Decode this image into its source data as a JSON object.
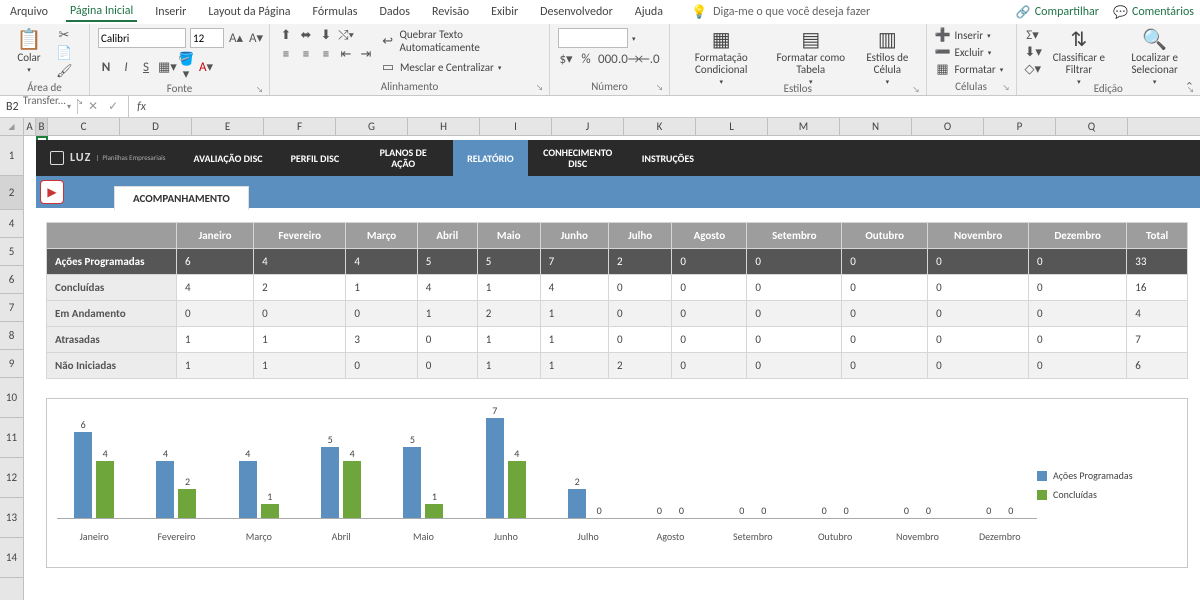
{
  "menubar": {
    "items": [
      "Arquivo",
      "Página Inicial",
      "Inserir",
      "Layout da Página",
      "Fórmulas",
      "Dados",
      "Revisão",
      "Exibir",
      "Desenvolvedor",
      "Ajuda"
    ],
    "active_index": 1,
    "tellme": "Diga-me o que você deseja fazer",
    "share": "Compartilhar",
    "comments": "Comentários"
  },
  "ribbon": {
    "clipboard": {
      "paste": "Colar",
      "label": "Área de Transfer..."
    },
    "font": {
      "name": "Calibri",
      "size": "12",
      "label": "Fonte"
    },
    "alignment": {
      "wrap": "Quebrar Texto Automaticamente",
      "merge": "Mesclar e Centralizar",
      "label": "Alinhamento"
    },
    "number": {
      "label": "Número"
    },
    "styles": {
      "cond": "Formatação Condicional",
      "table": "Formatar como Tabela",
      "cell": "Estilos de Célula",
      "label": "Estilos"
    },
    "cells": {
      "insert": "Inserir",
      "delete": "Excluir",
      "format": "Formatar",
      "label": "Células"
    },
    "editing": {
      "sort": "Classificar e Filtrar",
      "find": "Localizar e Selecionar",
      "label": "Edição"
    }
  },
  "formula_bar": {
    "cell_ref": "B2",
    "fx": "fx"
  },
  "columns": [
    "A",
    "B",
    "C",
    "D",
    "E",
    "F",
    "G",
    "H",
    "I",
    "J",
    "K",
    "L",
    "M",
    "N",
    "O",
    "P",
    "Q"
  ],
  "active_col": "B",
  "rows": [
    1,
    2,
    4,
    5,
    6,
    7,
    8,
    9,
    10,
    11,
    12,
    13,
    14
  ],
  "active_row": 2,
  "nav": {
    "brand": "LUZ",
    "brand_sub": "Planilhas Empresariais",
    "items": [
      "AVALIAÇÃO DISC",
      "PERFIL DISC",
      "PLANOS DE AÇÃO",
      "RELATÓRIO",
      "CONHECIMENTO DISC",
      "INSTRUÇÕES"
    ],
    "active_index": 3,
    "tab": "ACOMPANHAMENTO"
  },
  "table": {
    "months": [
      "Janeiro",
      "Fevereiro",
      "Março",
      "Abril",
      "Maio",
      "Junho",
      "Julho",
      "Agosto",
      "Setembro",
      "Outubro",
      "Novembro",
      "Dezembro",
      "Total"
    ],
    "rows": [
      {
        "label": "Ações Programadas",
        "vals": [
          6,
          4,
          4,
          5,
          5,
          7,
          2,
          0,
          0,
          0,
          0,
          0,
          33
        ],
        "highlight": true
      },
      {
        "label": "Concluídas",
        "vals": [
          4,
          2,
          1,
          4,
          1,
          4,
          0,
          0,
          0,
          0,
          0,
          0,
          16
        ]
      },
      {
        "label": "Em Andamento",
        "vals": [
          0,
          0,
          0,
          1,
          2,
          1,
          0,
          0,
          0,
          0,
          0,
          0,
          4
        ]
      },
      {
        "label": "Atrasadas",
        "vals": [
          1,
          1,
          3,
          0,
          1,
          1,
          0,
          0,
          0,
          0,
          0,
          0,
          7
        ]
      },
      {
        "label": "Não Iniciadas",
        "vals": [
          1,
          1,
          0,
          0,
          1,
          1,
          2,
          0,
          0,
          0,
          0,
          0,
          6
        ]
      }
    ]
  },
  "chart_data": {
    "type": "bar",
    "categories": [
      "Janeiro",
      "Fevereiro",
      "Março",
      "Abril",
      "Maio",
      "Junho",
      "Julho",
      "Agosto",
      "Setembro",
      "Outubro",
      "Novembro",
      "Dezembro"
    ],
    "series": [
      {
        "name": "Ações Programadas",
        "values": [
          6,
          4,
          4,
          5,
          5,
          7,
          2,
          0,
          0,
          0,
          0,
          0
        ],
        "color": "#5b8fbf"
      },
      {
        "name": "Concluídas",
        "values": [
          4,
          2,
          1,
          4,
          1,
          4,
          0,
          0,
          0,
          0,
          0,
          0
        ],
        "color": "#6ea63c"
      }
    ],
    "ylim": [
      0,
      7
    ],
    "title": "",
    "xlabel": "",
    "ylabel": ""
  }
}
